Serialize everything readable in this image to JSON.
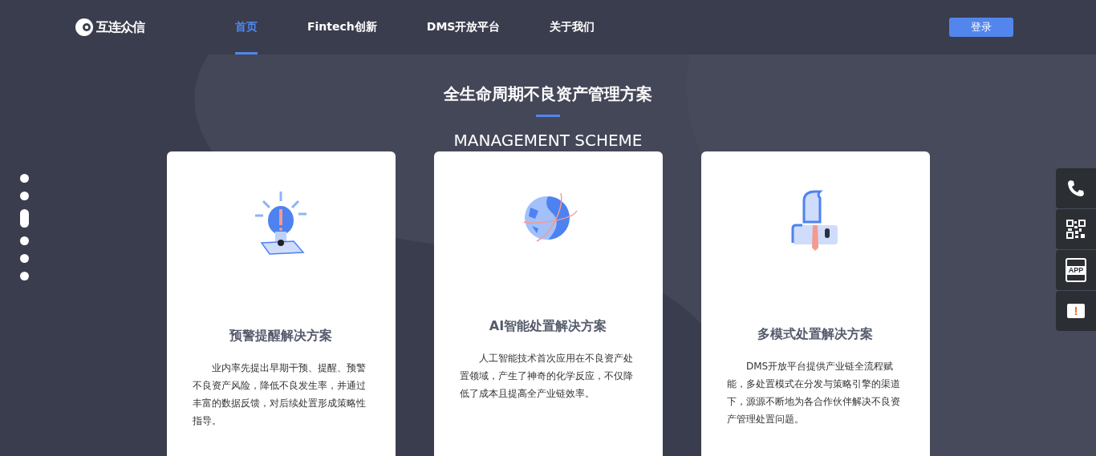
{
  "header": {
    "logo_text": "互连众信",
    "nav": [
      {
        "label": "首页",
        "selected": true
      },
      {
        "label": "Fintech创新",
        "selected": false
      },
      {
        "label": "DMS开放平台",
        "selected": false
      },
      {
        "label": "关于我们",
        "selected": false
      }
    ],
    "login_button": "登录"
  },
  "section": {
    "title": "全生命周期不良资产管理方案",
    "subtitle": "MANAGEMENT SCHEME"
  },
  "cards": [
    {
      "kind": "bulb",
      "title": "预警提醒解决方案",
      "text": "业内率先提出早期干预、提醒、预警不良资产风险，降低不良发生率，并通过丰富的数据反馈，对后续处置形成策略性指导。"
    },
    {
      "kind": "globe",
      "title": "AI智能处置解决方案",
      "text": "人工智能技术首次应用在不良资产处置领域，产生了神奇的化学反应，不仅降低了成本且提高全产业链效率。"
    },
    {
      "kind": "person",
      "title": "多模式处置解决方案",
      "text": "DMS开放平台提供产业链全流程赋能，多处置模式在分发与策略引擎的渠道下，源源不断地为各合作伙伴解决不良资产管理处置问题。"
    }
  ],
  "page_dots": [
    {
      "selected": false
    },
    {
      "selected": false
    },
    {
      "selected": true
    },
    {
      "selected": false
    },
    {
      "selected": false
    },
    {
      "selected": false
    }
  ],
  "side_tools": [
    {
      "kind": "phone"
    },
    {
      "kind": "qr"
    },
    {
      "kind": "app",
      "label": "APP"
    },
    {
      "kind": "feedback",
      "label": "!"
    }
  ]
}
